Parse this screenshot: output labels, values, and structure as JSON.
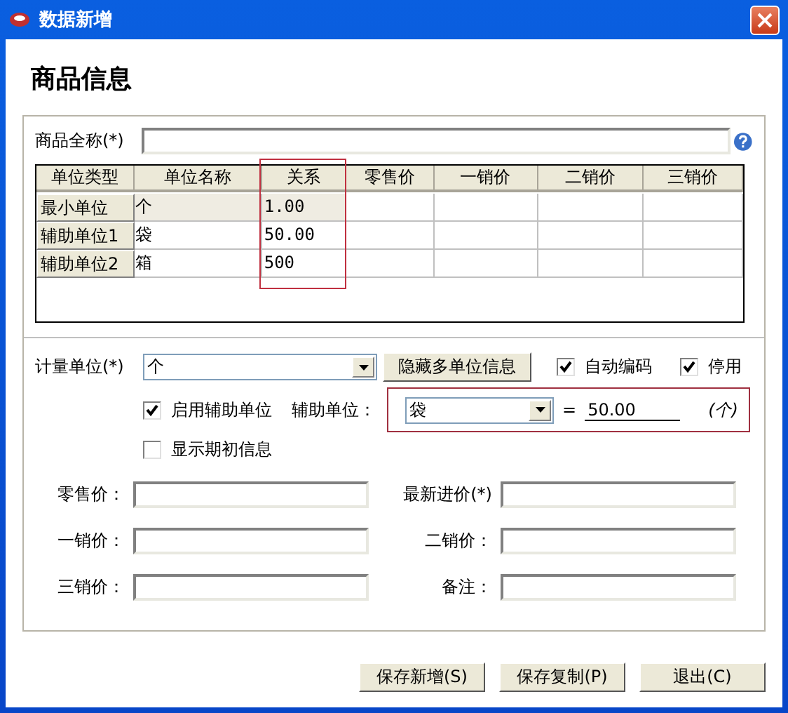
{
  "window": {
    "title": "数据新增"
  },
  "heading": "商品信息",
  "full_name": {
    "label": "商品全称(*)"
  },
  "units_table": {
    "columns": [
      "单位类型",
      "单位名称",
      "关系",
      "零售价",
      "一销价",
      "二销价",
      "三销价"
    ],
    "rows": [
      {
        "type": "最小单位",
        "name": "个",
        "ratio": "1.00",
        "readonly": true
      },
      {
        "type": "辅助单位1",
        "name": "袋",
        "ratio": "50.00",
        "readonly": false
      },
      {
        "type": "辅助单位2",
        "name": "箱",
        "ratio": "500",
        "readonly": false
      }
    ]
  },
  "unit": {
    "label": "计量单位(*)",
    "value": "个"
  },
  "toggle_button": "隐藏多单位信息",
  "auto_code": {
    "label": "自动编码",
    "checked": true
  },
  "stopped": {
    "label": "停用",
    "checked": true
  },
  "enable_aux": {
    "label": "启用辅助单位",
    "checked": true
  },
  "aux_unit": {
    "label": "辅助单位：",
    "value": "袋",
    "equals": "=",
    "ratio": "50.00",
    "base_unit": "(个)"
  },
  "show_initial": {
    "label": "显示期初信息",
    "checked": false
  },
  "price_fields": [
    {
      "label": "零售价："
    },
    {
      "label": "最新进价(*)"
    },
    {
      "label": "一销价："
    },
    {
      "label": "二销价："
    },
    {
      "label": "三销价："
    },
    {
      "label": "备注："
    }
  ],
  "buttons": [
    "保存新增(S)",
    "保存复制(P)",
    "退出(C)"
  ]
}
